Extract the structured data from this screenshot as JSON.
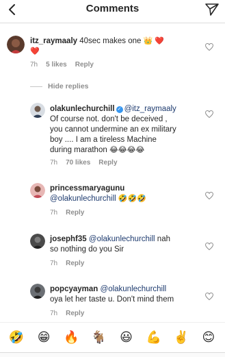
{
  "header": {
    "title": "Comments"
  },
  "top_comment": {
    "username": "itz_raymaaly",
    "text": "40sec makes one",
    "emojis_inline": "👑 ❤️",
    "emoji_wrap": "❤️",
    "time": "7h",
    "likes": "5 likes",
    "reply": "Reply"
  },
  "hide_replies": "Hide replies",
  "replies": [
    {
      "username": "olakunlechurchill",
      "mention": "@itz_raymaaly",
      "lines": [
        "Of course not.  don't be deceived ,",
        "you cannot undermine an ex military",
        "boy .... I am a tireless Machine",
        "during marathon"
      ],
      "emojis": "😂😂😂😂",
      "time": "7h",
      "likes": "70 likes",
      "reply": "Reply"
    },
    {
      "username": "princessmaryagunu",
      "mention": "@olakunlechurchill",
      "emojis": "🤣🤣🤣",
      "time": "7h",
      "reply": "Reply"
    },
    {
      "username": "josephf35",
      "mention": "@olakunlechurchill",
      "text_after": "nah",
      "line2": "so nothing do you Sir",
      "time": "7h",
      "reply": "Reply"
    },
    {
      "username": "popcyayman",
      "mention": "@olakunlechurchill",
      "line2": "oya let her taste u. Don't mind them",
      "time": "7h",
      "reply": "Reply"
    }
  ],
  "emoji_bar": [
    "🤣",
    "😁",
    "🔥",
    "🐐",
    "😃",
    "💪",
    "✌️",
    "😊"
  ]
}
